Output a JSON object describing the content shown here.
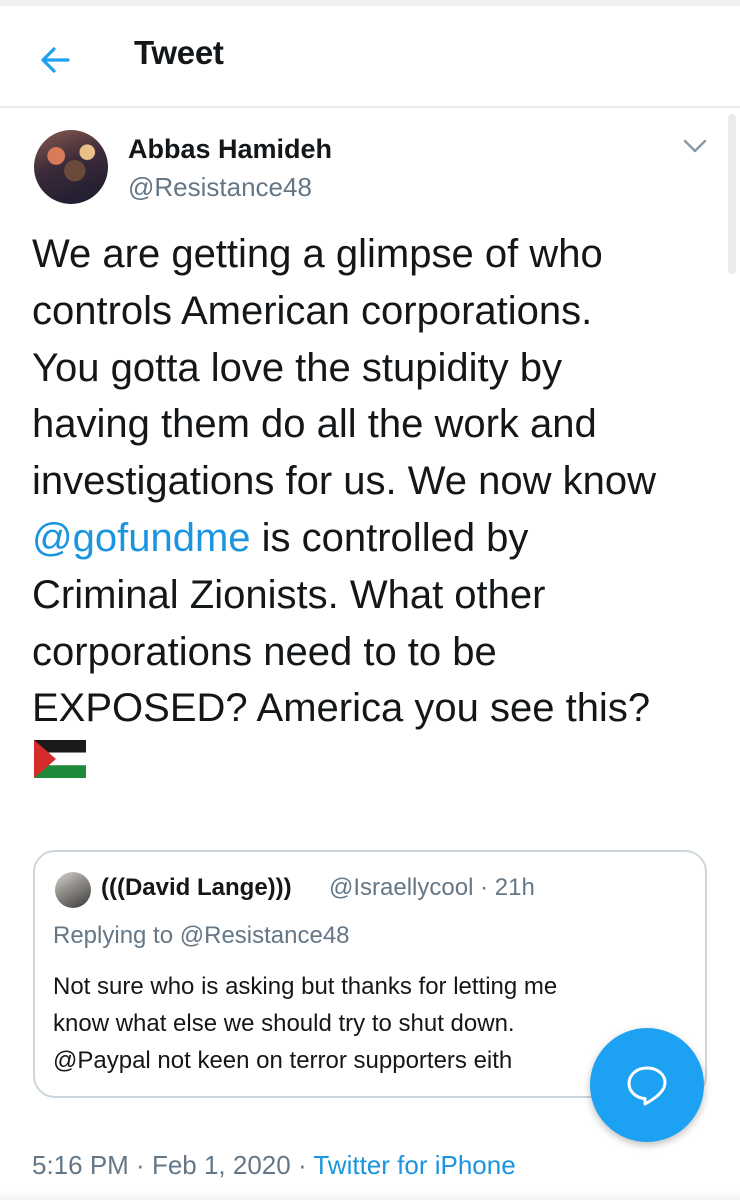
{
  "header": {
    "title": "Tweet"
  },
  "tweet": {
    "author_name": "Abbas Hamideh",
    "author_handle": "@Resistance48",
    "text_lines": [
      "We are getting a glimpse of who",
      "controls American corporations.",
      "You gotta love the stupidity by",
      "having them do all the work and",
      "investigations for us. We now know"
    ],
    "mention": "@gofundme",
    "mention_tail": " is controlled by",
    "text_lines_2": [
      "Criminal Zionists. What other",
      "corporations need to to be",
      "EXPOSED? America you see this?"
    ],
    "flag_icon": "palestine-flag-icon",
    "time": "5:16 PM",
    "separator": " · ",
    "date": "Feb 1, 2020",
    "source": "Twitter for iPhone"
  },
  "quoted_tweet": {
    "author_name": "(((David Lange)))",
    "author_handle": "@Israellycool",
    "age": "21h",
    "replying_prefix": "Replying to ",
    "replying_to": "@Resistance48",
    "text_lines": [
      "Not sure who is asking but thanks for letting me",
      "know what else we should try to shut down.",
      "@Paypal not keen on terror supporters eith"
    ]
  },
  "colors": {
    "link": "#1b95e0",
    "fab": "#1da1f2",
    "secondary_text": "#657786",
    "border": "#ccd6dd"
  },
  "icons": {
    "back": "arrow-left-icon",
    "caret": "chevron-down-icon",
    "fab": "speech-bubble-icon"
  }
}
